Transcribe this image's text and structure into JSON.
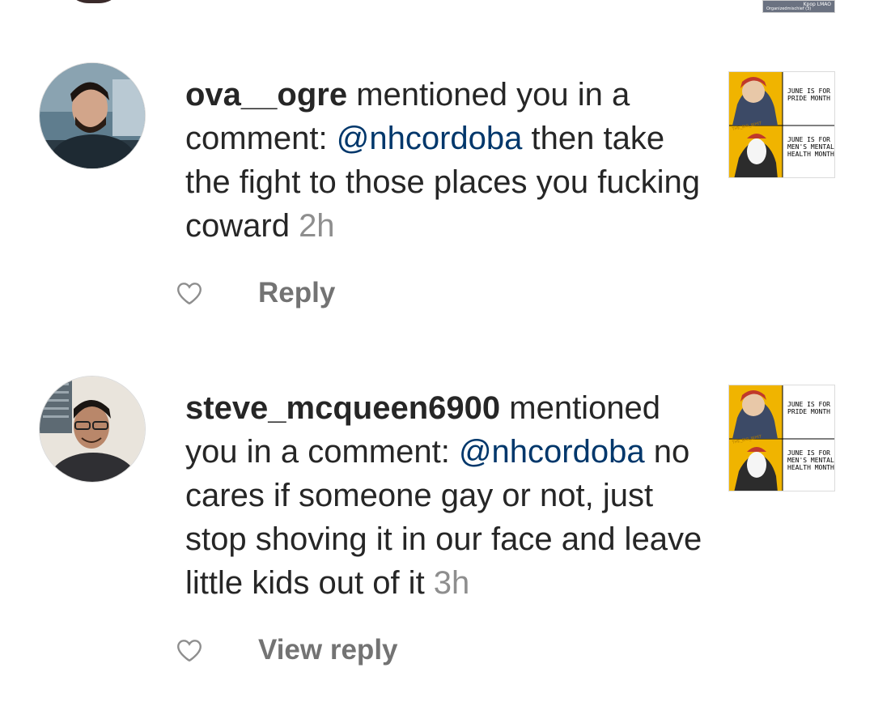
{
  "notifications": [
    {
      "username": "ova__ogre",
      "action": " mentioned you in a comment: ",
      "mention": "@nhcordoba",
      "comment": " then take the fight to those places you fucking coward ",
      "time": "2h",
      "reply_label": "Reply",
      "post_thumbnail": {
        "panel1_text": "JUNE IS FOR PRIDE MONTH",
        "panel2_text": "JUNE IS FOR MEN'S MENTAL HEALTH MONTH",
        "watermark": "THE_BIG_WHIT"
      }
    },
    {
      "username": "steve_mcqueen6900",
      "action": " mentioned you in a comment: ",
      "mention": "@nhcordoba",
      "comment": " no cares if someone gay or not, just stop shoving it in our face and leave little kids out of it ",
      "time": "3h",
      "reply_label": "View reply",
      "post_thumbnail": {
        "panel1_text": "JUNE IS FOR PRIDE MONTH",
        "panel2_text": "JUNE IS FOR MEN'S MENTAL HEALTH MONTH",
        "watermark": "THE_BIG_WHIT"
      }
    }
  ],
  "top_fragment": {
    "thumb_label": "Kpop LMAO",
    "thumb_caption": "Organizedmischief (3)"
  },
  "colors": {
    "text": "#262626",
    "mention": "#00376b",
    "secondary": "#8e8e8e",
    "reply": "#737373",
    "thumb_yellow": "#f0b400"
  },
  "icons": {
    "like": "heart-outline-icon"
  }
}
